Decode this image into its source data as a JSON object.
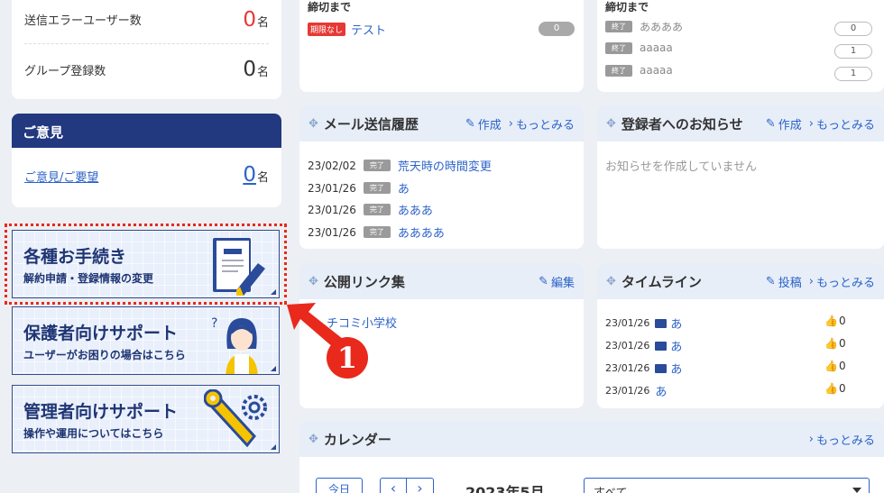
{
  "stats": {
    "send_error_label": "送信エラーユーザー数",
    "send_error_value": "0",
    "group_count_label": "グループ登録数",
    "group_count_value": "0",
    "unit": "名"
  },
  "feedback": {
    "title": "ご意見",
    "link": "ご意見/ご要望",
    "count": "0",
    "unit": "名"
  },
  "big_buttons": [
    {
      "title": "各種お手続き",
      "subtitle": "解約申請・登録情報の変更"
    },
    {
      "title": "保護者向けサポート",
      "subtitle": "ユーザーがお困りの場合はこちら"
    },
    {
      "title": "管理者向けサポート",
      "subtitle": "操作や運用についてはこちら"
    }
  ],
  "deadline_left": {
    "header": "締切まで",
    "badge": "期限なし",
    "item": "テスト",
    "count": "0"
  },
  "deadline_right": {
    "header": "締切まで",
    "status": "終了",
    "items": [
      {
        "title": "ああああ",
        "count": "0"
      },
      {
        "title": "aaaaa",
        "count": "1"
      },
      {
        "title": "aaaaa",
        "count": "1"
      }
    ]
  },
  "mail_history": {
    "title": "メール送信履歴",
    "create": "作成",
    "more": "もっとみる",
    "status": "完了",
    "rows": [
      {
        "date": "23/02/02",
        "subject": "荒天時の時間変更"
      },
      {
        "date": "23/01/26",
        "subject": "あ"
      },
      {
        "date": "23/01/26",
        "subject": "あああ"
      },
      {
        "date": "23/01/26",
        "subject": "ああああ"
      }
    ]
  },
  "notices": {
    "title": "登録者へのお知らせ",
    "create": "作成",
    "more": "もっとみる",
    "empty": "お知らせを作成していません"
  },
  "public_links": {
    "title": "公開リンク集",
    "edit": "編集",
    "item": "チコミ小学校"
  },
  "timeline": {
    "title": "タイムライン",
    "post": "投稿",
    "more": "もっとみる",
    "rows": [
      {
        "date": "23/01/26",
        "text": "あ",
        "likes": "0",
        "image": true
      },
      {
        "date": "23/01/26",
        "text": "あ",
        "likes": "0",
        "image": true
      },
      {
        "date": "23/01/26",
        "text": "あ",
        "likes": "0",
        "image": true
      },
      {
        "date": "23/01/26",
        "text": "あ",
        "likes": "0",
        "image": false
      }
    ]
  },
  "calendar": {
    "title": "カレンダー",
    "more": "もっとみる",
    "today": "今日",
    "prev": "‹",
    "next": "›",
    "month": "2023年5月",
    "filter": "すべて"
  },
  "annotation": {
    "marker": "1",
    "color": "#e8291c"
  },
  "colors": {
    "navy": "#1f3573",
    "link": "#2c63c9",
    "red": "#e53935"
  }
}
